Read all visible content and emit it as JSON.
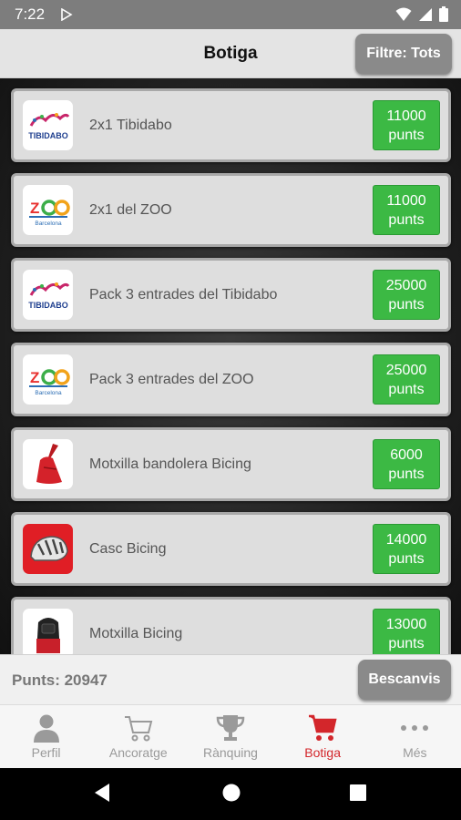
{
  "status": {
    "time": "7:22"
  },
  "header": {
    "title": "Botiga",
    "filter_label": "Filtre: Tots"
  },
  "items": [
    {
      "name": "2x1 Tibidabo",
      "points": "11000",
      "unit": "punts",
      "logo": "tibidabo-logo"
    },
    {
      "name": "2x1 del ZOO",
      "points": "11000",
      "unit": "punts",
      "logo": "zoo-barcelona-logo"
    },
    {
      "name": "Pack 3 entrades del Tibidabo",
      "points": "25000",
      "unit": "punts",
      "logo": "tibidabo-logo"
    },
    {
      "name": "Pack 3 entrades del ZOO",
      "points": "25000",
      "unit": "punts",
      "logo": "zoo-barcelona-logo"
    },
    {
      "name": "Motxilla bandolera Bicing",
      "points": "6000",
      "unit": "punts",
      "logo": "sling-bag-image"
    },
    {
      "name": "Casc Bicing",
      "points": "14000",
      "unit": "punts",
      "logo": "helmet-image"
    },
    {
      "name": "Motxilla Bicing",
      "points": "13000",
      "unit": "punts",
      "logo": "backpack-image"
    }
  ],
  "footer": {
    "points_label": "Punts: 20947",
    "redeem_label": "Bescanvis"
  },
  "tabs": [
    {
      "label": "Perfil",
      "icon": "person-icon"
    },
    {
      "label": "Ancoratge",
      "icon": "cart-outline-icon"
    },
    {
      "label": "Rànquing",
      "icon": "trophy-icon"
    },
    {
      "label": "Botiga",
      "icon": "cart-icon",
      "active": true
    },
    {
      "label": "Més",
      "icon": "more-dots-icon"
    }
  ],
  "colors": {
    "accent": "#d3262b",
    "price_green": "#3cb944",
    "button_gray": "#8a8a8a"
  }
}
